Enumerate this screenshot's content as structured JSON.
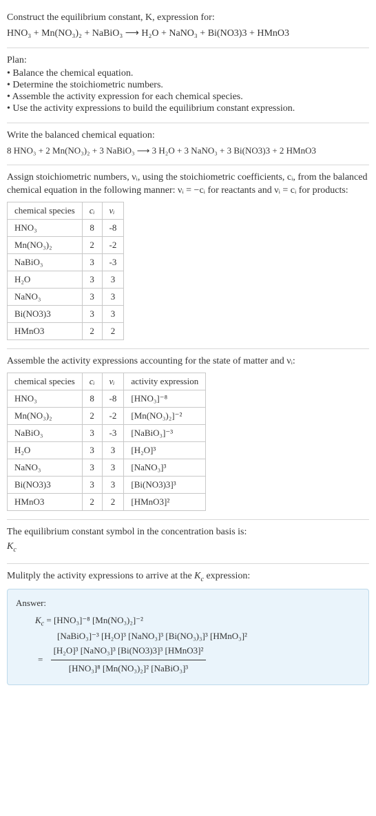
{
  "intro": {
    "line1": "Construct the equilibrium constant, K, expression for:",
    "equation": "HNO₃ + Mn(NO₃)₂ + NaBiO₃  ⟶  H₂O + NaNO₃ + Bi(NO3)3 + HMnO3"
  },
  "plan": {
    "heading": "Plan:",
    "items": [
      "• Balance the chemical equation.",
      "• Determine the stoichiometric numbers.",
      "• Assemble the activity expression for each chemical species.",
      "• Use the activity expressions to build the equilibrium constant expression."
    ]
  },
  "balanced": {
    "heading": "Write the balanced chemical equation:",
    "equation": "8 HNO₃ + 2 Mn(NO₃)₂ + 3 NaBiO₃  ⟶  3 H₂O + 3 NaNO₃ + 3 Bi(NO3)3 + 2 HMnO3"
  },
  "stoich": {
    "intro": "Assign stoichiometric numbers, νᵢ, using the stoichiometric coefficients, cᵢ, from the balanced chemical equation in the following manner: νᵢ = −cᵢ for reactants and νᵢ = cᵢ for products:",
    "headers": {
      "species": "chemical species",
      "ci": "cᵢ",
      "vi": "νᵢ"
    },
    "rows": [
      {
        "species": "HNO₃",
        "ci": "8",
        "vi": "-8"
      },
      {
        "species": "Mn(NO₃)₂",
        "ci": "2",
        "vi": "-2"
      },
      {
        "species": "NaBiO₃",
        "ci": "3",
        "vi": "-3"
      },
      {
        "species": "H₂O",
        "ci": "3",
        "vi": "3"
      },
      {
        "species": "NaNO₃",
        "ci": "3",
        "vi": "3"
      },
      {
        "species": "Bi(NO3)3",
        "ci": "3",
        "vi": "3"
      },
      {
        "species": "HMnO3",
        "ci": "2",
        "vi": "2"
      }
    ]
  },
  "activity": {
    "intro": "Assemble the activity expressions accounting for the state of matter and νᵢ:",
    "headers": {
      "species": "chemical species",
      "ci": "cᵢ",
      "vi": "νᵢ",
      "act": "activity expression"
    },
    "rows": [
      {
        "species": "HNO₃",
        "ci": "8",
        "vi": "-8",
        "act": "[HNO₃]⁻⁸"
      },
      {
        "species": "Mn(NO₃)₂",
        "ci": "2",
        "vi": "-2",
        "act": "[Mn(NO₃)₂]⁻²"
      },
      {
        "species": "NaBiO₃",
        "ci": "3",
        "vi": "-3",
        "act": "[NaBiO₃]⁻³"
      },
      {
        "species": "H₂O",
        "ci": "3",
        "vi": "3",
        "act": "[H₂O]³"
      },
      {
        "species": "NaNO₃",
        "ci": "3",
        "vi": "3",
        "act": "[NaNO₃]³"
      },
      {
        "species": "Bi(NO3)3",
        "ci": "3",
        "vi": "3",
        "act": "[Bi(NO3)3]³"
      },
      {
        "species": "HMnO3",
        "ci": "2",
        "vi": "2",
        "act": "[HMnO3]²"
      }
    ]
  },
  "kcsymbol": {
    "line1": "The equilibrium constant symbol in the concentration basis is:",
    "line2": "K_c"
  },
  "multiply": {
    "line": "Mulitply the activity expressions to arrive at the K_c expression:"
  },
  "answer": {
    "label": "Answer:",
    "line1": "K_c = [HNO₃]⁻⁸ [Mn(NO₃)₂]⁻²",
    "line2": "[NaBiO₃]⁻³ [H₂O]³ [NaNO₃]³ [Bi(NO₃)₃]³ [HMnO₃]²",
    "frac_num": "[H₂O]³ [NaNO₃]³ [Bi(NO3)3]³ [HMnO3]²",
    "frac_den": "[HNO₃]⁸ [Mn(NO₃)₂]² [NaBiO₃]³",
    "eq": "="
  },
  "chart_data": {
    "type": "table",
    "tables": [
      {
        "title": "Stoichiometric numbers",
        "columns": [
          "chemical species",
          "c_i",
          "ν_i"
        ],
        "rows": [
          [
            "HNO3",
            8,
            -8
          ],
          [
            "Mn(NO3)2",
            2,
            -2
          ],
          [
            "NaBiO3",
            3,
            -3
          ],
          [
            "H2O",
            3,
            3
          ],
          [
            "NaNO3",
            3,
            3
          ],
          [
            "Bi(NO3)3",
            3,
            3
          ],
          [
            "HMnO3",
            2,
            2
          ]
        ]
      },
      {
        "title": "Activity expressions",
        "columns": [
          "chemical species",
          "c_i",
          "ν_i",
          "activity expression"
        ],
        "rows": [
          [
            "HNO3",
            8,
            -8,
            "[HNO3]^-8"
          ],
          [
            "Mn(NO3)2",
            2,
            -2,
            "[Mn(NO3)2]^-2"
          ],
          [
            "NaBiO3",
            3,
            -3,
            "[NaBiO3]^-3"
          ],
          [
            "H2O",
            3,
            3,
            "[H2O]^3"
          ],
          [
            "NaNO3",
            3,
            3,
            "[NaNO3]^3"
          ],
          [
            "Bi(NO3)3",
            3,
            3,
            "[Bi(NO3)3]^3"
          ],
          [
            "HMnO3",
            2,
            2,
            "[HMnO3]^2"
          ]
        ]
      }
    ]
  }
}
